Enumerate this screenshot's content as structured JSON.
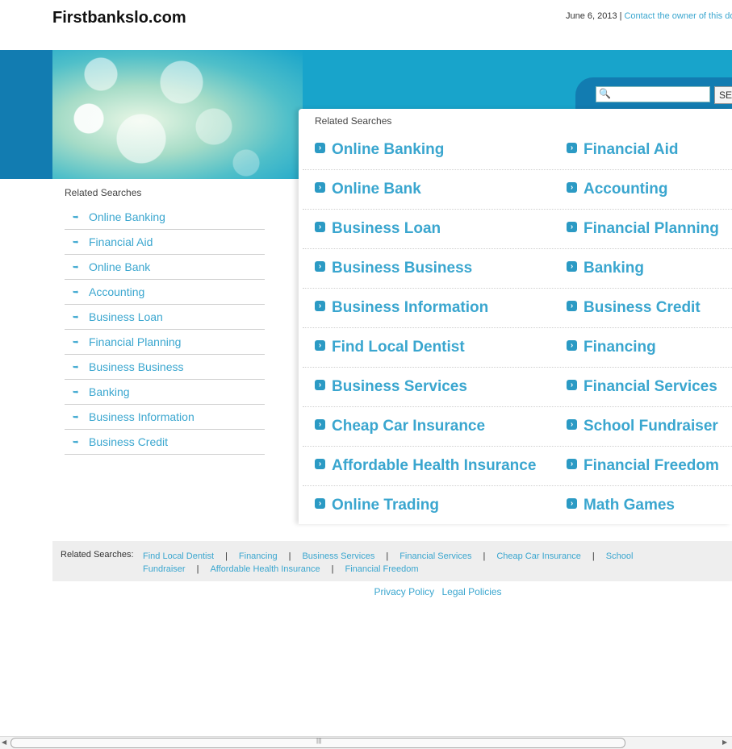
{
  "header": {
    "site_title": "Firstbankslo.com",
    "date": "June 6, 2013",
    "separator": "|",
    "contact_link": "Contact the owner of this domain"
  },
  "search": {
    "placeholder": "",
    "button_label": "SEARCH",
    "icon": "magnifier-icon"
  },
  "main": {
    "heading": "Related Searches",
    "left_column": [
      "Online Banking",
      "Online Bank",
      "Business Loan",
      "Business Business",
      "Business Information",
      "Find Local Dentist",
      "Business Services",
      "Cheap Car Insurance",
      "Affordable Health Insurance",
      "Online Trading"
    ],
    "right_column": [
      "Financial Aid",
      "Accounting",
      "Financial Planning",
      "Banking",
      "Business Credit",
      "Financing",
      "Financial Services",
      "School Fundraiser",
      "Financial Freedom",
      "Math Games"
    ]
  },
  "sidebar": {
    "heading": "Related Searches",
    "items": [
      "Online Banking",
      "Financial Aid",
      "Online Bank",
      "Accounting",
      "Business Loan",
      "Financial Planning",
      "Business Business",
      "Banking",
      "Business Information",
      "Business Credit"
    ]
  },
  "footer": {
    "label": "Related Searches:",
    "links": [
      "Find Local Dentist",
      "Financing",
      "Business Services",
      "Financial Services",
      "Cheap Car Insurance",
      "School Fundraiser",
      "Affordable Health Insurance",
      "Financial Freedom"
    ],
    "separator": "|",
    "privacy": "Privacy Policy",
    "legal": "Legal Policies"
  },
  "colors": {
    "link": "#3aa6cf",
    "banner": "#18a4cb",
    "banner_dark": "#127cb1"
  }
}
